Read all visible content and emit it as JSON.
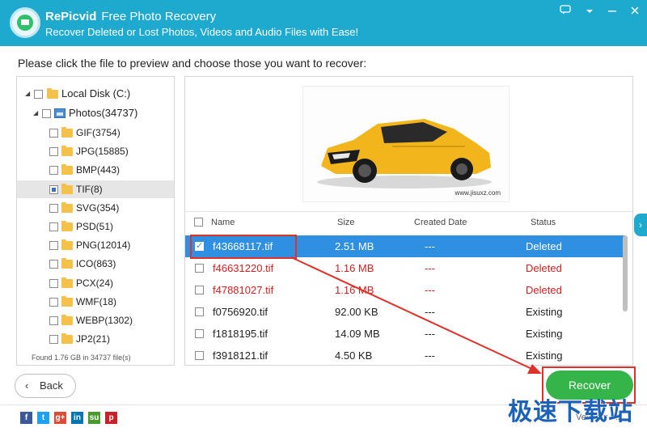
{
  "header": {
    "brand": "RePicvid",
    "product": "Free Photo Recovery",
    "subtitle": "Recover Deleted or Lost Photos, Videos and Audio Files with Ease!",
    "controls": [
      "feedback-icon",
      "menu-icon",
      "minimize-icon",
      "close-icon"
    ]
  },
  "instruction": "Please click the file to preview and choose those you want to recover:",
  "tree": {
    "root": "Local Disk (C:)",
    "photos": "Photos(34737)",
    "items": [
      {
        "label": "GIF(3754)"
      },
      {
        "label": "JPG(15885)"
      },
      {
        "label": "BMP(443)"
      },
      {
        "label": "TIF(8)",
        "selected": true
      },
      {
        "label": "SVG(354)"
      },
      {
        "label": "PSD(51)"
      },
      {
        "label": "PNG(12014)"
      },
      {
        "label": "ICO(863)"
      },
      {
        "label": "PCX(24)"
      },
      {
        "label": "WMF(18)"
      },
      {
        "label": "WEBP(1302)"
      },
      {
        "label": "JP2(21)"
      }
    ],
    "footer": "Found 1.76 GB in 34737 file(s)"
  },
  "preview": {
    "watermark": "www.jisuxz.com"
  },
  "table": {
    "headers": {
      "name": "Name",
      "size": "Size",
      "date": "Created Date",
      "status": "Status"
    },
    "rows": [
      {
        "name": "f43668117.tif",
        "size": "2.51 MB",
        "date": "---",
        "status": "Deleted",
        "deleted": true,
        "selected": true
      },
      {
        "name": "f46631220.tif",
        "size": "1.16 MB",
        "date": "---",
        "status": "Deleted",
        "deleted": true
      },
      {
        "name": "f47881027.tif",
        "size": "1.16 MB",
        "date": "---",
        "status": "Deleted",
        "deleted": true
      },
      {
        "name": "f0756920.tif",
        "size": "92.00 KB",
        "date": "---",
        "status": "Existing"
      },
      {
        "name": "f1818195.tif",
        "size": "14.09 MB",
        "date": "---",
        "status": "Existing"
      },
      {
        "name": "f3918121.tif",
        "size": "4.50 KB",
        "date": "---",
        "status": "Existing"
      }
    ]
  },
  "buttons": {
    "back": "Back",
    "recover": "Recover"
  },
  "footer": {
    "social": [
      {
        "icon": "facebook-icon",
        "glyph": "f",
        "color": "#3b5998"
      },
      {
        "icon": "twitter-icon",
        "glyph": "t",
        "color": "#1da1f2"
      },
      {
        "icon": "googleplus-icon",
        "glyph": "g+",
        "color": "#dd4b39"
      },
      {
        "icon": "linkedin-icon",
        "glyph": "in",
        "color": "#0077b5"
      },
      {
        "icon": "stumbleupon-icon",
        "glyph": "su",
        "color": "#4a9b2f"
      },
      {
        "icon": "pinterest-icon",
        "glyph": "p",
        "color": "#cb2027"
      }
    ],
    "version": "Version: 2.2"
  },
  "watermark_cn": "极速下载站",
  "colors": {
    "accent": "#1ea9cf",
    "selected_row": "#2f8fe0",
    "recover": "#35b449",
    "deleted_text": "#d02020",
    "highlight": "#e0302a"
  }
}
